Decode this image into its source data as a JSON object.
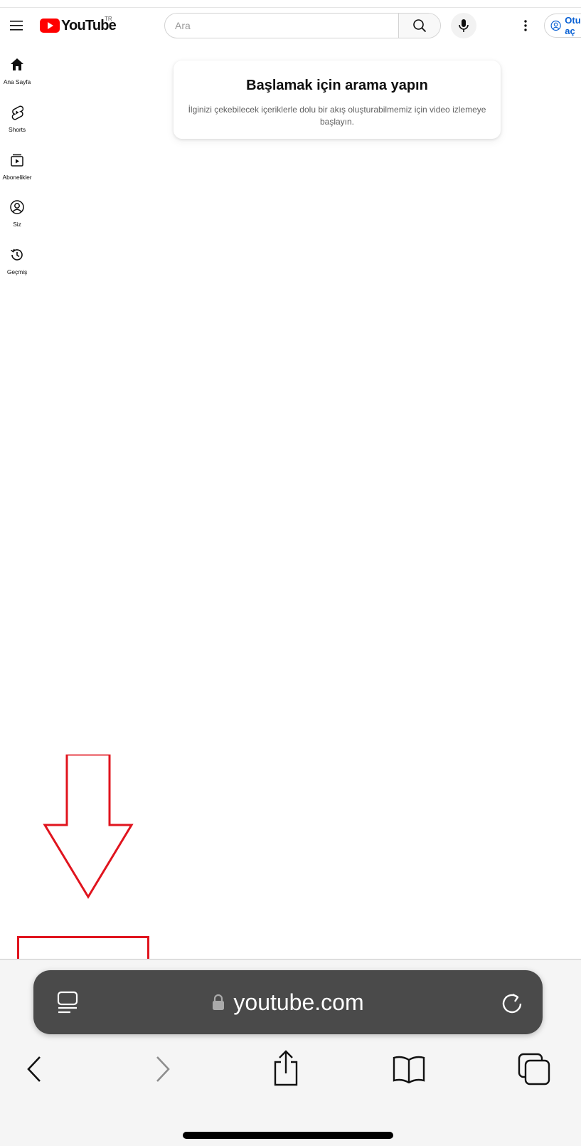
{
  "header": {
    "logo_text": "YouTube",
    "country_code": "TR",
    "search_placeholder": "Ara",
    "signin_label": "Oturum aç"
  },
  "sidebar": {
    "items": [
      {
        "label": "Ana Sayfa",
        "icon": "home-icon"
      },
      {
        "label": "Shorts",
        "icon": "shorts-icon"
      },
      {
        "label": "Abonelikler",
        "icon": "subscriptions-icon"
      },
      {
        "label": "Siz",
        "icon": "you-icon"
      },
      {
        "label": "Geçmiş",
        "icon": "history-icon"
      }
    ]
  },
  "main": {
    "card_title": "Başlamak için arama yapın",
    "card_subtitle": "İlginizi çekebilecek içeriklerle dolu bir akış oluşturabilmemiz için video izlemeye başlayın."
  },
  "browser": {
    "url": "youtube.com",
    "icons": [
      "reader-icon",
      "lock-icon",
      "reload-icon",
      "back-icon",
      "forward-icon",
      "share-icon",
      "bookmarks-icon",
      "tabs-icon"
    ]
  },
  "colors": {
    "youtube_red": "#ff0000",
    "annotation_red": "#e0141e",
    "url_bar_bg": "#4a4a4a",
    "signin_blue": "#065fd4"
  }
}
